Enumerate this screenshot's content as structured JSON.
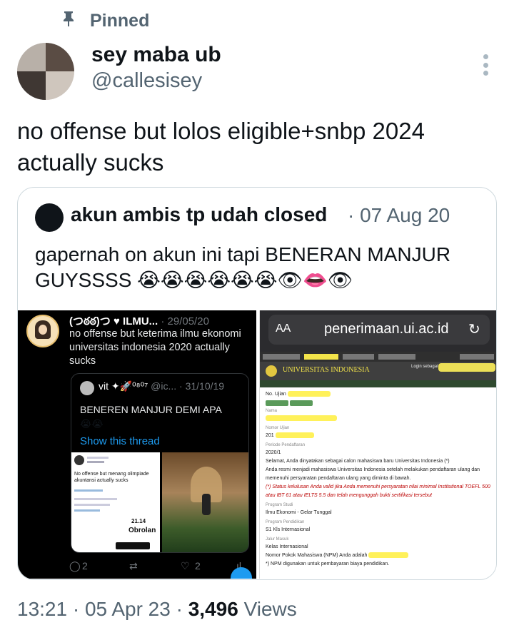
{
  "pinned": {
    "label": "Pinned",
    "icon": "pin-icon"
  },
  "author": {
    "name": "sey maba ub",
    "handle": "@callesisey"
  },
  "tweet": {
    "text": "no offense but lolos eligible+snbp 2024 actually sucks"
  },
  "quote": {
    "name": "akun ambis tp udah closed",
    "date": "· 07 Aug 20",
    "text": "gapernah on akun ini tapi BENERAN MANJUR GUYSSSS",
    "emojis": "😭😭😭😭😭😭👁👄👁",
    "screenshot_left": {
      "name": "(つఠఠ)つ ♥ ILMU...",
      "date": "· 29/05/20",
      "text": "no offense but keterima ilmu ekonomi universitas indonesia 2020 actually sucks",
      "quote_name": "vit ✦🚀⁰⁸⁰⁷",
      "quote_handle": "@ic...",
      "quote_date": "· 31/10/19",
      "quote_text": "BENEREN MANJUR DEMI APA",
      "quote_emoji": "😭😭",
      "show_thread": "Show this thread",
      "inner_text": "No offense but menang olimpiade akuntansi actually sucks",
      "inner_num": "21.14",
      "inner_word": "Obrolan",
      "reply_count": "2",
      "like_count": "2"
    },
    "screenshot_right": {
      "aa": "AA",
      "url": "penerimaan.ui.ac.id",
      "reload": "↻",
      "university": "UNIVERSITAS INDONESIA",
      "login": "Login sebagai",
      "no_ujian": "No. Ujian",
      "nama_label": "Nama",
      "nomor_ujian_label": "Nomor Ujian",
      "nomor_ujian": "201",
      "periode_label": "Periode Pendaftaran",
      "periode": "2020/1",
      "selamat": "Selamat, Anda dinyatakan sebagai calon mahasiswa baru Universitas Indonesia (*)",
      "resmi": "Anda resmi menjadi mahasiswa Universitas Indonesia setelah melakukan pendaftaran ulang dan memenuhi persyaratan pendaftaran ulang yang diminta di bawah.",
      "status": "(*) Status kelulusan Anda valid jika Anda memenuhi persyaratan nilai minimal Institutional TOEFL 500 atau IBT 61 atau IELTS 5.5 dan telah mengunggah bukti sertifikasi tersebut",
      "program_studi_label": "Program Studi",
      "program_studi": "Ilmu Ekonomi - Gelar Tunggal",
      "program_pendidikan_label": "Program Pendidikan",
      "program_pendidikan": "S1 Kls Internasional",
      "jalur_label": "Jalur Masuk",
      "jalur": "Kelas Internasional",
      "npm": "Nomor Pokok Mahasiswa (NPM) Anda adalah",
      "npm_note": "*) NPM digunakan untuk pembayaran biaya pendidikan."
    }
  },
  "meta": {
    "time": "13:21 · 05 Apr 23 · ",
    "views": "3,496",
    "views_label": " Views"
  },
  "colors": {
    "secondary": "#536471",
    "text": "#0f1419",
    "border": "#cfd9de",
    "link": "#1d9bf0"
  }
}
